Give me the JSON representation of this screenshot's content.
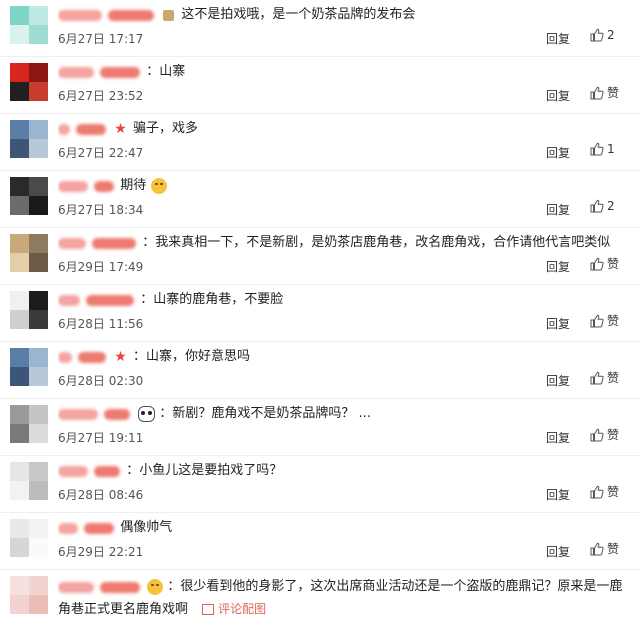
{
  "comments": [
    {
      "text": "这不是拍戏哦，是一个奶茶品牌的发布会",
      "date": "6月27日 17:17",
      "reply": "回复",
      "likes": "2",
      "has_badge": true,
      "avatar_colors": [
        "#7fd6c8",
        "#bfe9e2",
        "#d9f2ee",
        "#9fdcd2"
      ]
    },
    {
      "text": "：山寨",
      "date": "6月27日 23:52",
      "reply": "回复",
      "likes": "赞",
      "avatar_colors": [
        "#d6261e",
        "#8a1712",
        "#202020",
        "#c73c2f"
      ]
    },
    {
      "text": "骗子，戏多",
      "date": "6月27日 22:47",
      "reply": "回复",
      "likes": "1",
      "has_star": true,
      "avatar_colors": [
        "#5a7ea8",
        "#9ab6d1",
        "#3d5677",
        "#b8c8d8"
      ]
    },
    {
      "text": "期待",
      "date": "6月27日 18:34",
      "reply": "回复",
      "likes": "2",
      "emoji": true,
      "avatar_colors": [
        "#2a2a2a",
        "#4a4a4a",
        "#6b6b6b",
        "#1a1a1a"
      ]
    },
    {
      "text": "：我来真相一下，不是新剧，是奶茶店鹿角巷，改名鹿角戏，合作请他代言吧类似",
      "date": "6月29日 17:49",
      "reply": "回复",
      "likes": "赞",
      "avatar_colors": [
        "#c9a87a",
        "#8d7a5f",
        "#e2cfa9",
        "#6d5b45"
      ]
    },
    {
      "text": "：山寨的鹿角巷，不要脸",
      "date": "6月28日 11:56",
      "reply": "回复",
      "likes": "赞",
      "avatar_colors": [
        "#f0f0f0",
        "#1c1c1c",
        "#cfcfcf",
        "#3a3a3a"
      ]
    },
    {
      "text": "：山寨，你好意思吗",
      "date": "6月28日 02:30",
      "reply": "回复",
      "likes": "赞",
      "has_star": true,
      "avatar_colors": [
        "#5a7ea8",
        "#9ab6d1",
        "#3d5677",
        "#b8c8d8"
      ]
    },
    {
      "text": "：新剧？鹿角戏不是奶茶品牌吗？ ...",
      "date": "6月27日 19:11",
      "reply": "回复",
      "likes": "赞",
      "panda": true,
      "avatar_colors": [
        "#9a9a9a",
        "#c4c4c4",
        "#7a7a7a",
        "#dcdcdc"
      ]
    },
    {
      "text": "：小鱼儿这是要拍戏了吗？",
      "date": "6月28日 08:46",
      "reply": "回复",
      "likes": "赞",
      "avatar_colors": [
        "#e5e5e5",
        "#c9c9c9",
        "#f2f2f2",
        "#bcbcbc"
      ]
    },
    {
      "text": "偶像帅气",
      "date": "6月29日 22:21",
      "reply": "回复",
      "likes": "赞",
      "avatar_colors": [
        "#e8e8e8",
        "#f3f3f3",
        "#d6d6d6",
        "#fafafa"
      ]
    }
  ],
  "last_comment": {
    "line1": "：很少看到他的身影了，这次出席商业活动还是一个盗版的鹿鼎记？原来是一鹿",
    "line2": "角巷正式更名鹿角戏啊",
    "link": "评论配图"
  },
  "colors": {
    "blur_pink": "#f4a3a0",
    "blur_red": "#ee7a70",
    "link": "#e0655a",
    "divider": "#eeeeee"
  }
}
